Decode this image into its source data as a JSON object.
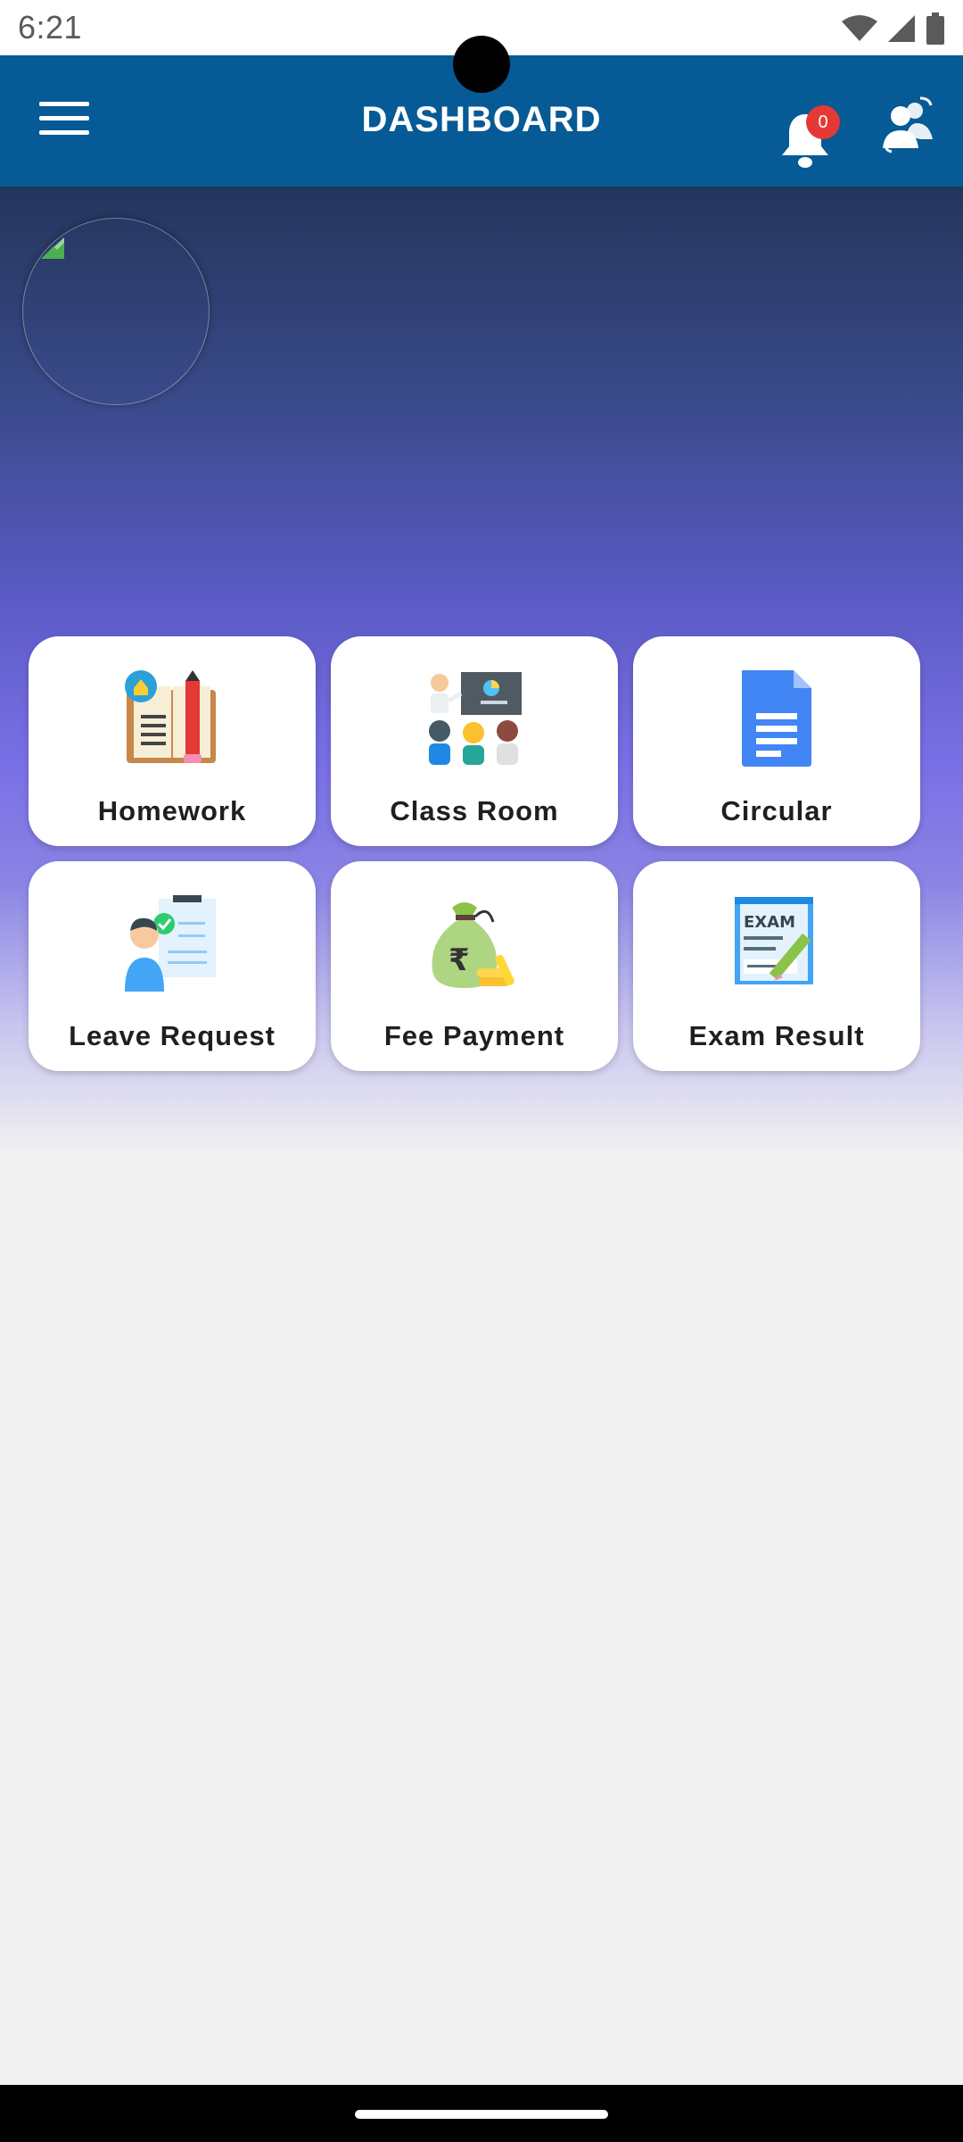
{
  "status_bar": {
    "time": "6:21",
    "icons": [
      "wifi-icon",
      "cellular-signal-icon",
      "battery-icon"
    ]
  },
  "app_bar": {
    "title": "DASHBOARD",
    "notification_count": "0",
    "icons": [
      "menu-icon",
      "bell-icon",
      "switch-user-icon"
    ],
    "background_color": "#065a96"
  },
  "profile": {
    "avatar_icon": "broken-image-icon"
  },
  "tiles": [
    {
      "label": "Homework",
      "icon": "homework-book-icon"
    },
    {
      "label": "Class Room",
      "icon": "classroom-icon"
    },
    {
      "label": "Circular",
      "icon": "document-icon"
    },
    {
      "label": "Leave Request",
      "icon": "leave-request-icon"
    },
    {
      "label": "Fee Payment",
      "icon": "money-bag-icon"
    },
    {
      "label": "Exam Result",
      "icon": "exam-icon"
    }
  ],
  "colors": {
    "accent": "#065a96",
    "badge": "#e53935",
    "gradient_top": "#24355c",
    "gradient_mid": "#7a70e6"
  }
}
